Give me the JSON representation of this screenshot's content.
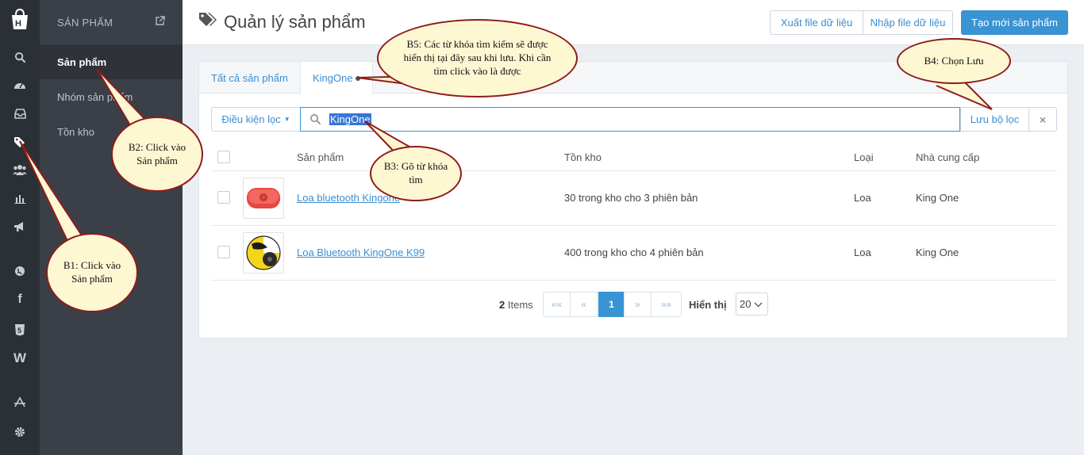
{
  "sidebar": {
    "header": "SẢN PHẨM",
    "items": [
      {
        "label": "Sản phẩm",
        "active": true
      },
      {
        "label": "Nhóm sản phẩm",
        "active": false
      },
      {
        "label": "Tồn kho",
        "active": false
      }
    ]
  },
  "header": {
    "title": "Quản lý sản phẩm",
    "export_label": "Xuất file dữ liệu",
    "import_label": "Nhập file dữ liệu",
    "create_label": "Tạo mới sản phẩm"
  },
  "tabs": [
    {
      "label": "Tất cả sản phẩm"
    },
    {
      "label": "KingOne"
    }
  ],
  "filter": {
    "condition_label": "Điều kiện lọc",
    "search_value": "KingOne",
    "save_label": "Lưu bộ lọc",
    "clear_symbol": "×"
  },
  "table": {
    "columns": [
      "Sản phẩm",
      "Tồn kho",
      "Loại",
      "Nhà cung cấp"
    ],
    "rows": [
      {
        "name": "Loa bluetooth Kingone",
        "stock": "30 trong kho cho 3 phiên bản",
        "type": "Loa",
        "supplier": "King One"
      },
      {
        "name": "Loa Bluetooth KingOne K99",
        "stock": "400 trong kho cho 4 phiên bản",
        "type": "Loa",
        "supplier": "King One"
      }
    ]
  },
  "pagination": {
    "count": "2",
    "items_label": "Items",
    "first": "««",
    "prev": "«",
    "current": "1",
    "next": "»",
    "last": "»»",
    "show_label": "Hiển thị",
    "page_size": "20"
  },
  "callouts": {
    "b1": "B1: Click vào Sản phẩm",
    "b2": "B2: Click vào Sản phẩm",
    "b3": "B3: Gõ từ khóa tìm",
    "b4": "B4: Chọn Lưu",
    "b5": "B5: Các từ khóa tìm kiếm sẽ được hiển thị tại đây sau khi lưu. Khi cần tìm click vào là được"
  },
  "colors": {
    "accent": "#3a93d3",
    "rail_bg": "#2b2f36",
    "sidebar_bg": "#3b4048",
    "callout_fill": "#fdf7d2",
    "callout_border": "#8e1b1b"
  }
}
